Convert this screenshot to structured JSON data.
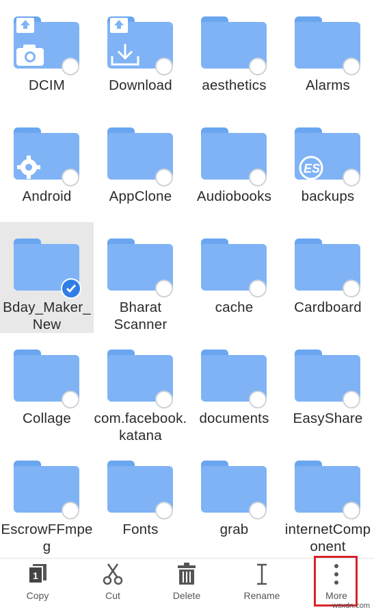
{
  "folders": [
    {
      "name": "DCIM"
    },
    {
      "name": "Download"
    },
    {
      "name": "aesthetics"
    },
    {
      "name": "Alarms"
    },
    {
      "name": "Android"
    },
    {
      "name": "AppClone"
    },
    {
      "name": "Audiobooks"
    },
    {
      "name": "backups"
    },
    {
      "name": "Bday_Maker_New"
    },
    {
      "name": "Bharat Scanner"
    },
    {
      "name": "cache"
    },
    {
      "name": "Cardboard"
    },
    {
      "name": "Collage"
    },
    {
      "name": "com.facebook.katana"
    },
    {
      "name": "documents"
    },
    {
      "name": "EasyShare"
    },
    {
      "name": "EscrowFFmpeg"
    },
    {
      "name": "Fonts"
    },
    {
      "name": "grab"
    },
    {
      "name": "internetComponent"
    }
  ],
  "toolbar": {
    "copy_label": "Copy",
    "cut_label": "Cut",
    "delete_label": "Delete",
    "rename_label": "Rename",
    "more_label": "More"
  },
  "watermark": "wsxdn.com",
  "colors": {
    "folder": "#7fb3f5",
    "accent": "#2f7de6",
    "highlight": "#d8232a"
  }
}
